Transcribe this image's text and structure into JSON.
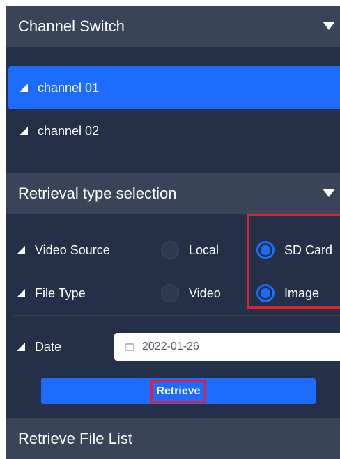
{
  "channel_switch": {
    "title": "Channel Switch",
    "channels": [
      {
        "label": "channel 01",
        "active": true
      },
      {
        "label": "channel 02",
        "active": false
      }
    ]
  },
  "retrieval_type": {
    "title": "Retrieval type selection",
    "video_source": {
      "label": "Video Source",
      "options": [
        "Local",
        "SD Card"
      ],
      "selected": "SD Card"
    },
    "file_type": {
      "label": "File Type",
      "options": [
        "Video",
        "Image"
      ],
      "selected": "Image"
    },
    "date": {
      "label": "Date",
      "value": "2022-01-26"
    },
    "retrieve_button": "Retrieve"
  },
  "file_list": {
    "title": "Retrieve File List"
  },
  "colors": {
    "accent": "#1e6cff",
    "panel_bg": "#243048",
    "header_bg": "#3a4458",
    "highlight": "#e0202e"
  }
}
